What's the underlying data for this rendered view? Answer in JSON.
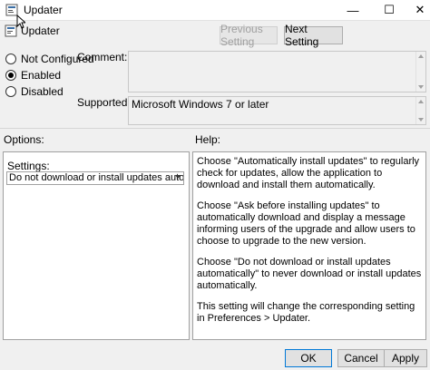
{
  "window": {
    "title": "Updater",
    "icon": "policy-window-icon",
    "controls": {
      "minimize": "—",
      "maximize": "☐",
      "close": "✕"
    }
  },
  "policy": {
    "name": "Updater",
    "icon": "policy-setting-icon"
  },
  "nav": {
    "prev_label": "Previous Setting",
    "next_label": "Next Setting"
  },
  "state": {
    "options": [
      {
        "label": "Not Configured",
        "checked": false
      },
      {
        "label": "Enabled",
        "checked": true
      },
      {
        "label": "Disabled",
        "checked": false
      }
    ]
  },
  "comment": {
    "label": "Comment:",
    "value": ""
  },
  "supported": {
    "label": "Supported on:",
    "value": "Microsoft Windows 7 or later"
  },
  "options_section": {
    "label": "Options:",
    "settings_label": "Settings:",
    "selected_value": "Do not download or install updates automatically"
  },
  "help_section": {
    "label": "Help:",
    "paragraphs": [
      "Choose \"Automatically install updates\" to regularly check for updates, allow the application to download and install them automatically.",
      "Choose \"Ask before installing updates\" to automatically download and display a message informing users of the upgrade and allow users to choose to upgrade to the new version.",
      "Choose \"Do not download or install updates automatically\" to never download or install updates automatically.",
      "This setting will change the corresponding setting in Preferences > Updater."
    ]
  },
  "footer": {
    "ok_label": "OK",
    "cancel_label": "Cancel",
    "apply_label": "Apply"
  },
  "colors": {
    "accent": "#0078d7",
    "background": "#f0f0f0"
  }
}
